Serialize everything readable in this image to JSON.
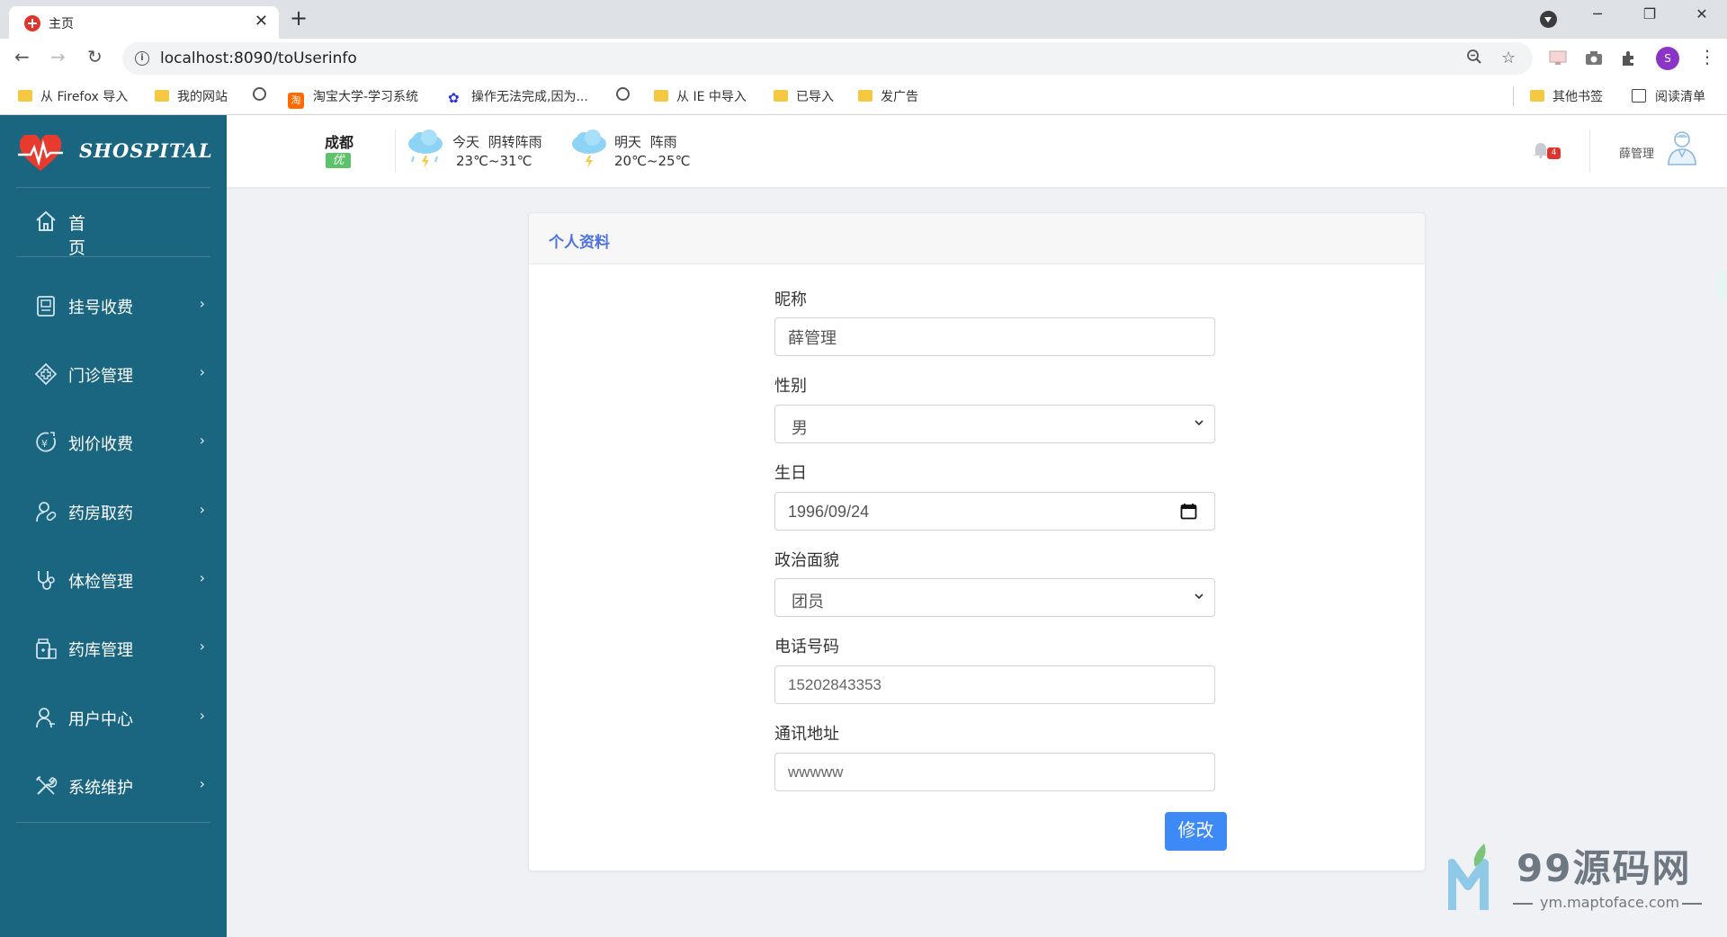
{
  "browser": {
    "tab_title": "主页",
    "tab_close": "✕",
    "new_tab": "+",
    "url": "localhost:8090/toUserinfo",
    "profile_initial": "S",
    "bookmarks": [
      {
        "type": "folder",
        "label": "从 Firefox 导入"
      },
      {
        "type": "folder",
        "label": "我的网站"
      },
      {
        "type": "globe",
        "label": ""
      },
      {
        "type": "taobao",
        "label": "淘宝大学-学习系统"
      },
      {
        "type": "baidu",
        "label": "操作无法完成,因为..."
      },
      {
        "type": "globe",
        "label": ""
      },
      {
        "type": "folder",
        "label": "从 IE 中导入"
      },
      {
        "type": "folder",
        "label": "已导入"
      },
      {
        "type": "folder",
        "label": "发广告"
      }
    ],
    "other_bookmarks": "其他书签",
    "reading_list": "阅读清单"
  },
  "app": {
    "logo_text": "SHOSPITAL",
    "home_label": "首 页",
    "menu": [
      {
        "label": "挂号收费",
        "icon": "register-fee-icon"
      },
      {
        "label": "门诊管理",
        "icon": "outpatient-icon"
      },
      {
        "label": "划价收费",
        "icon": "pricing-fee-icon"
      },
      {
        "label": "药房取药",
        "icon": "pharmacy-icon"
      },
      {
        "label": "体检管理",
        "icon": "stethoscope-icon"
      },
      {
        "label": "药库管理",
        "icon": "drug-store-icon"
      },
      {
        "label": "用户中心",
        "icon": "user-center-icon"
      },
      {
        "label": "系统维护",
        "icon": "tools-icon"
      }
    ],
    "chevron": "›"
  },
  "header": {
    "city": "成都",
    "aqi": "优",
    "today_label": "今天",
    "today_weather": "阴转阵雨",
    "today_temp": "23℃~31℃",
    "tomorrow_label": "明天",
    "tomorrow_weather": "阵雨",
    "tomorrow_temp": "20℃~25℃",
    "notification_count": "4",
    "user_name": "薛管理"
  },
  "card": {
    "title": "个人资料",
    "fields": {
      "nickname_label": "昵称",
      "nickname_value": "薛管理",
      "gender_label": "性别",
      "gender_value": "男",
      "birthday_label": "生日",
      "birthday_value": "1996/09/24",
      "political_label": "政治面貌",
      "political_value": "团员",
      "phone_label": "电话号码",
      "phone_value": "15202843353",
      "address_label": "通讯地址",
      "address_value": "wwwww"
    },
    "submit_label": "修改"
  },
  "watermark": {
    "text": "99源码网",
    "url": "ym.maptoface.com"
  },
  "colors": {
    "sidebar": "#1a6580",
    "accent": "#4e73df",
    "button": "#3d8af7",
    "badge": "#e0342f"
  }
}
